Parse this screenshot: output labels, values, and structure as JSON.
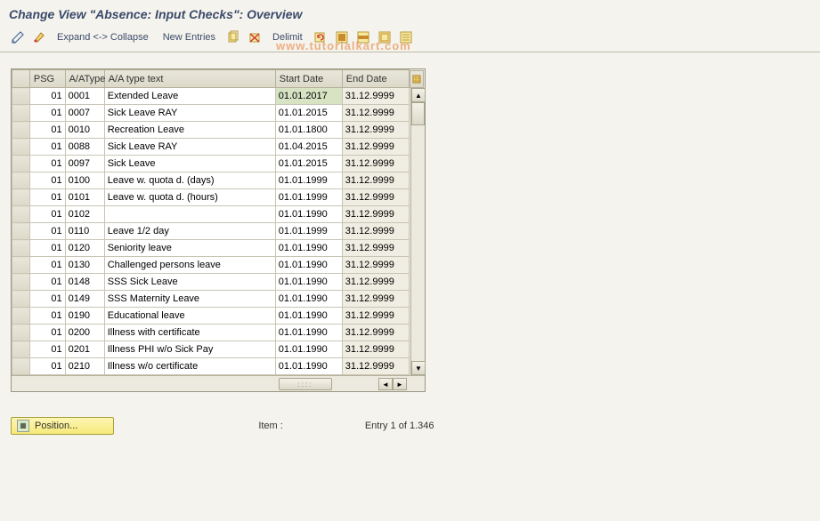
{
  "title": "Change View \"Absence: Input Checks\": Overview",
  "watermark": "www.tutorialkart.com",
  "toolbar": {
    "expand_collapse": "Expand <-> Collapse",
    "new_entries": "New Entries",
    "delimit": "Delimit"
  },
  "columns": {
    "psg": "PSG",
    "aatype": "A/AType",
    "aatext": "A/A type text",
    "start": "Start Date",
    "end": "End Date"
  },
  "rows": [
    {
      "psg": "01",
      "type": "0001",
      "text": "Extended Leave",
      "start": "01.01.2017",
      "end": "31.12.9999",
      "hl": true
    },
    {
      "psg": "01",
      "type": "0007",
      "text": "Sick Leave RAY",
      "start": "01.01.2015",
      "end": "31.12.9999"
    },
    {
      "psg": "01",
      "type": "0010",
      "text": "Recreation Leave",
      "start": "01.01.1800",
      "end": "31.12.9999"
    },
    {
      "psg": "01",
      "type": "0088",
      "text": "Sick Leave RAY",
      "start": "01.04.2015",
      "end": "31.12.9999"
    },
    {
      "psg": "01",
      "type": "0097",
      "text": "Sick Leave",
      "start": "01.01.2015",
      "end": "31.12.9999"
    },
    {
      "psg": "01",
      "type": "0100",
      "text": "Leave w. quota d. (days)",
      "start": "01.01.1999",
      "end": "31.12.9999"
    },
    {
      "psg": "01",
      "type": "0101",
      "text": "Leave w. quota d. (hours)",
      "start": "01.01.1999",
      "end": "31.12.9999"
    },
    {
      "psg": "01",
      "type": "0102",
      "text": "",
      "start": "01.01.1990",
      "end": "31.12.9999"
    },
    {
      "psg": "01",
      "type": "0110",
      "text": "Leave 1/2 day",
      "start": "01.01.1999",
      "end": "31.12.9999"
    },
    {
      "psg": "01",
      "type": "0120",
      "text": "Seniority leave",
      "start": "01.01.1990",
      "end": "31.12.9999"
    },
    {
      "psg": "01",
      "type": "0130",
      "text": "Challenged persons leave",
      "start": "01.01.1990",
      "end": "31.12.9999"
    },
    {
      "psg": "01",
      "type": "0148",
      "text": "SSS Sick Leave",
      "start": "01.01.1990",
      "end": "31.12.9999"
    },
    {
      "psg": "01",
      "type": "0149",
      "text": "SSS Maternity Leave",
      "start": "01.01.1990",
      "end": "31.12.9999"
    },
    {
      "psg": "01",
      "type": "0190",
      "text": "Educational leave",
      "start": "01.01.1990",
      "end": "31.12.9999"
    },
    {
      "psg": "01",
      "type": "0200",
      "text": "Illness with certificate",
      "start": "01.01.1990",
      "end": "31.12.9999"
    },
    {
      "psg": "01",
      "type": "0201",
      "text": "Illness PHI w/o Sick Pay",
      "start": "01.01.1990",
      "end": "31.12.9999"
    },
    {
      "psg": "01",
      "type": "0210",
      "text": "Illness w/o certificate",
      "start": "01.01.1990",
      "end": "31.12.9999"
    }
  ],
  "footer": {
    "position": "Position...",
    "item": "Item   :",
    "entry": "Entry 1 of 1.346"
  }
}
